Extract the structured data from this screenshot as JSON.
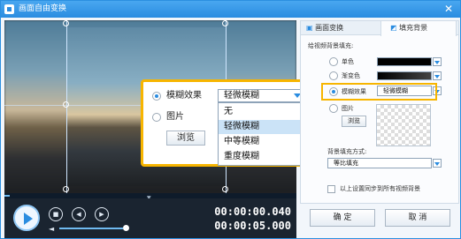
{
  "window": {
    "title": "画面自由变换"
  },
  "player": {
    "time_current": "00:00:00.040",
    "time_total": "00:00:05.000"
  },
  "callout": {
    "blur_label": "模糊效果",
    "blur_value": "轻微模糊",
    "image_label": "图片",
    "browse_label": "浏览",
    "dropdown_options": [
      "无",
      "轻微模糊",
      "中等模糊",
      "重度模糊"
    ],
    "dropdown_selected": "轻微模糊"
  },
  "panel": {
    "tabs": [
      {
        "label": "画面变换",
        "icon": "crop-icon"
      },
      {
        "label": "填充背景",
        "icon": "fill-icon"
      }
    ],
    "active_tab": "填充背景",
    "section_title": "给视频背景填充:",
    "options": [
      {
        "label": "单色"
      },
      {
        "label": "渐变色"
      },
      {
        "label": "模糊效果",
        "value": "轻微模糊"
      },
      {
        "label": "图片"
      }
    ],
    "selected_option": "模糊效果",
    "browse_label": "浏览",
    "fill_mode_title": "背景填充方式:",
    "fill_mode_value": "等比填充",
    "sync_label": "以上设置同步到所有视频背景"
  },
  "buttons": {
    "ok": "确 定",
    "cancel": "取 消"
  },
  "colors": {
    "accent": "#2a8ce0",
    "highlight": "#f7b500",
    "titlebar": "#3a9be8"
  }
}
